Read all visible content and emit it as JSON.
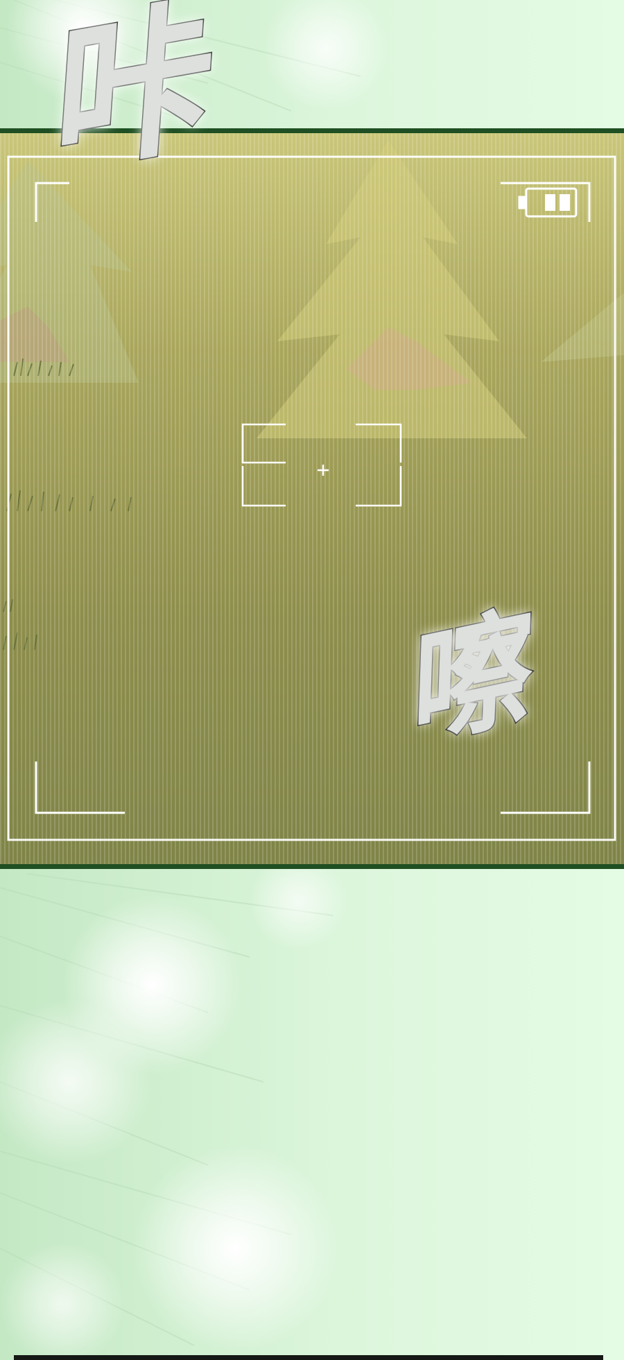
{
  "sound_effects": {
    "top": "咔",
    "bottom": "嚓"
  },
  "viewfinder": {
    "battery_icon": "battery-icon",
    "focus_icon": "focus-crosshair-icon",
    "battery_level": 0.5
  },
  "colors": {
    "background": "#e4fbe4",
    "panel_border": "#1f4f22",
    "scene_tint": "#a8a862",
    "overlay_lines": "#ffffff"
  }
}
